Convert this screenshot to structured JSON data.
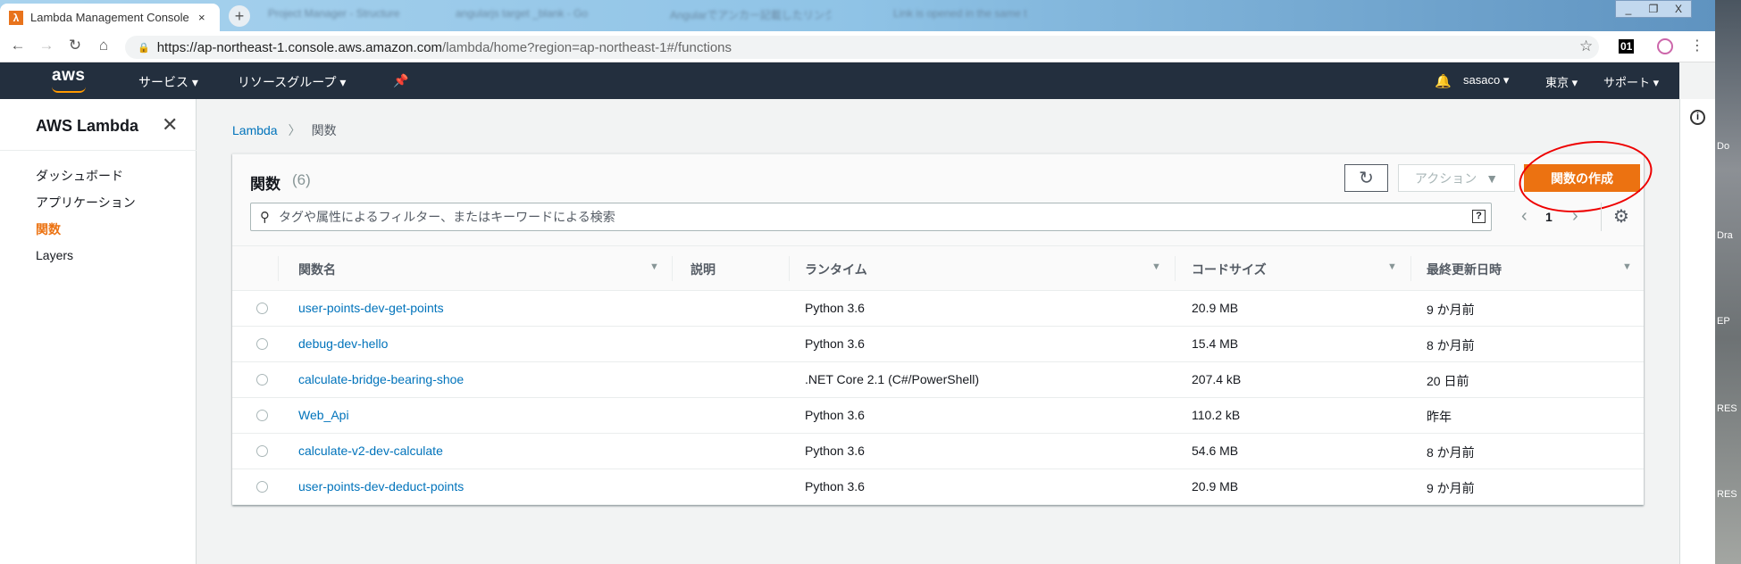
{
  "browser": {
    "active_tab": "Lambda Management Console",
    "bg_tabs": [
      "Project Manager - Structure",
      "angularjs target _blank - Go",
      "Angularでアンカー記載したリンク",
      "Link is opened in the same t"
    ],
    "url_host": "https://ap-northeast-1.console.aws.amazon.com",
    "url_path": "/lambda/home?region=ap-northeast-1#/functions",
    "ext_label": "01",
    "win": [
      "_",
      "❐",
      "X"
    ]
  },
  "nav": {
    "logo": "aws",
    "services": "サービス",
    "resource_groups": "リソースグループ",
    "user": "sasaco",
    "region": "東京",
    "support": "サポート"
  },
  "sidebar": {
    "title": "AWS Lambda",
    "items": [
      {
        "label": "ダッシュボード"
      },
      {
        "label": "アプリケーション"
      },
      {
        "label": "関数"
      },
      {
        "label": "Layers"
      }
    ]
  },
  "breadcrumb": {
    "root": "Lambda",
    "current": "関数"
  },
  "panel": {
    "title": "関数",
    "count": "(6)",
    "action_label": "アクション",
    "create_label": "関数の作成",
    "search_placeholder": "タグや属性によるフィルター、またはキーワードによる検索",
    "help": "?",
    "page": "1"
  },
  "columns": [
    "関数名",
    "説明",
    "ランタイム",
    "コードサイズ",
    "最終更新日時"
  ],
  "rows": [
    {
      "name": "user-points-dev-get-points",
      "runtime": "Python 3.6",
      "size": "20.9 MB",
      "modified": "9 か月前"
    },
    {
      "name": "debug-dev-hello",
      "runtime": "Python 3.6",
      "size": "15.4 MB",
      "modified": "8 か月前"
    },
    {
      "name": "calculate-bridge-bearing-shoe",
      "runtime": ".NET Core 2.1 (C#/PowerShell)",
      "size": "207.4 kB",
      "modified": "20 日前"
    },
    {
      "name": "Web_Api",
      "runtime": "Python 3.6",
      "size": "110.2 kB",
      "modified": "昨年"
    },
    {
      "name": "calculate-v2-dev-calculate",
      "runtime": "Python 3.6",
      "size": "54.6 MB",
      "modified": "8 か月前"
    },
    {
      "name": "user-points-dev-deduct-points",
      "runtime": "Python 3.6",
      "size": "20.9 MB",
      "modified": "9 か月前"
    }
  ],
  "desktop": [
    "Do",
    "Dra",
    "EP",
    "RES",
    "RES"
  ]
}
